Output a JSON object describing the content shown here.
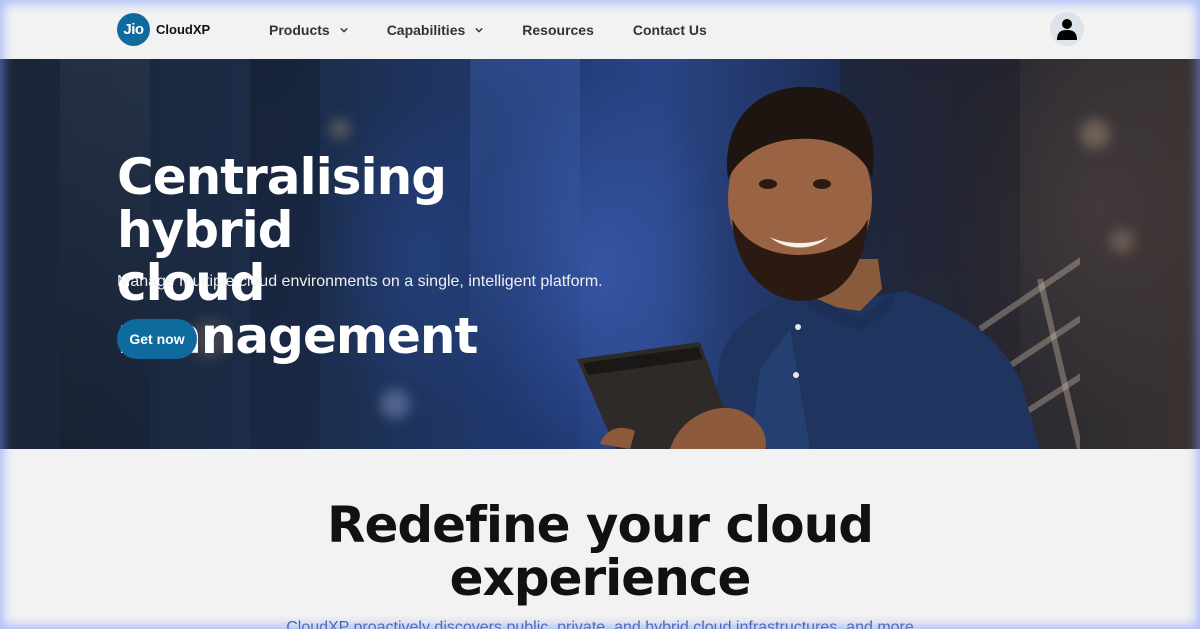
{
  "header": {
    "logo_mark": "Jio",
    "logo_text": "CloudXP",
    "nav": [
      {
        "label": "Products",
        "has_dropdown": true,
        "icon": "chevron-down-icon"
      },
      {
        "label": "Capabilities",
        "has_dropdown": true,
        "icon": "chevron-down-icon"
      },
      {
        "label": "Resources",
        "has_dropdown": false
      },
      {
        "label": "Contact Us",
        "has_dropdown": false
      }
    ],
    "account_icon": "user-icon"
  },
  "hero": {
    "title_line1": "Centralising hybrid",
    "title_line2": "cloud management",
    "subtitle": "Manage multiple cloud environments on a single, intelligent platform.",
    "cta_label": "Get now"
  },
  "section": {
    "title_line1": "Redefine your cloud",
    "title_line2": "experience",
    "text": "CloudXP proactively discovers public, private, and hybrid cloud infrastructures, and more"
  },
  "colors": {
    "brand": "#0f6a9e",
    "page_bg": "#f2f2f2",
    "heading": "#111111"
  }
}
